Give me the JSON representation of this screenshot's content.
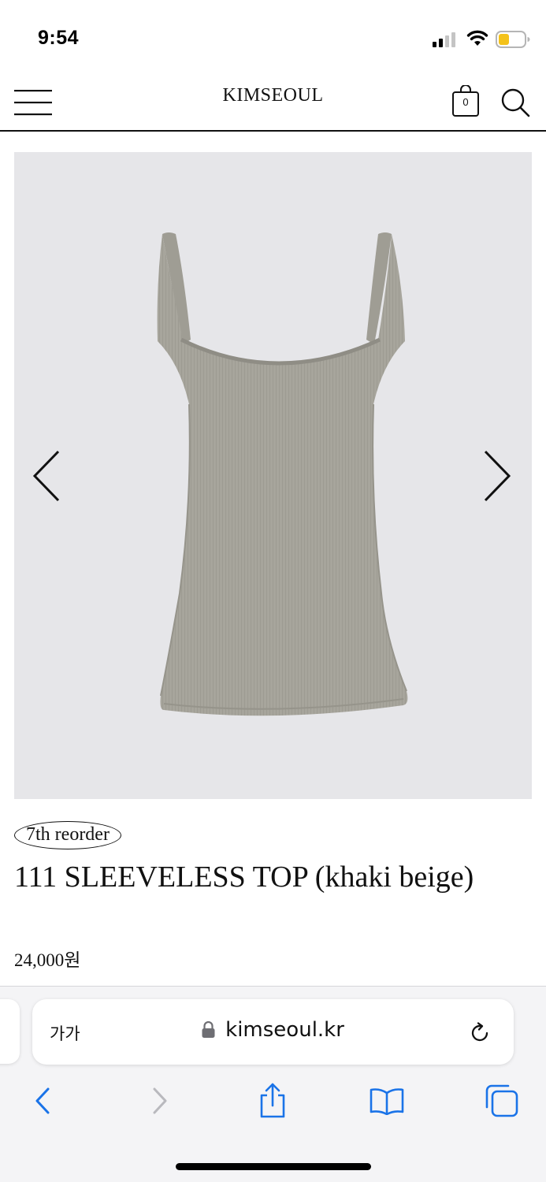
{
  "status_bar": {
    "time": "9:54",
    "icons": [
      "signal-icon",
      "wifi-icon",
      "battery-icon"
    ],
    "battery_color": "#f4c21a"
  },
  "header": {
    "logo": "KIMSEOUL",
    "cart_count": "0",
    "icons": [
      "menu-icon",
      "cart-icon",
      "search-icon"
    ]
  },
  "gallery": {
    "background_color": "#e6e6e9",
    "product_color": "#a7a59c",
    "icons": [
      "chevron-left-icon",
      "chevron-right-icon"
    ]
  },
  "product": {
    "badge": "7th reorder",
    "title": "111 SLEEVELESS TOP (khaki beige)",
    "price": "24,000원"
  },
  "browser": {
    "text_size_label": "가가",
    "url": "kimseoul.kr",
    "accent_color": "#1a73e8",
    "icons": [
      "lock-icon",
      "reload-icon",
      "back-icon",
      "forward-icon",
      "share-icon",
      "bookmarks-icon",
      "tabs-icon"
    ]
  }
}
